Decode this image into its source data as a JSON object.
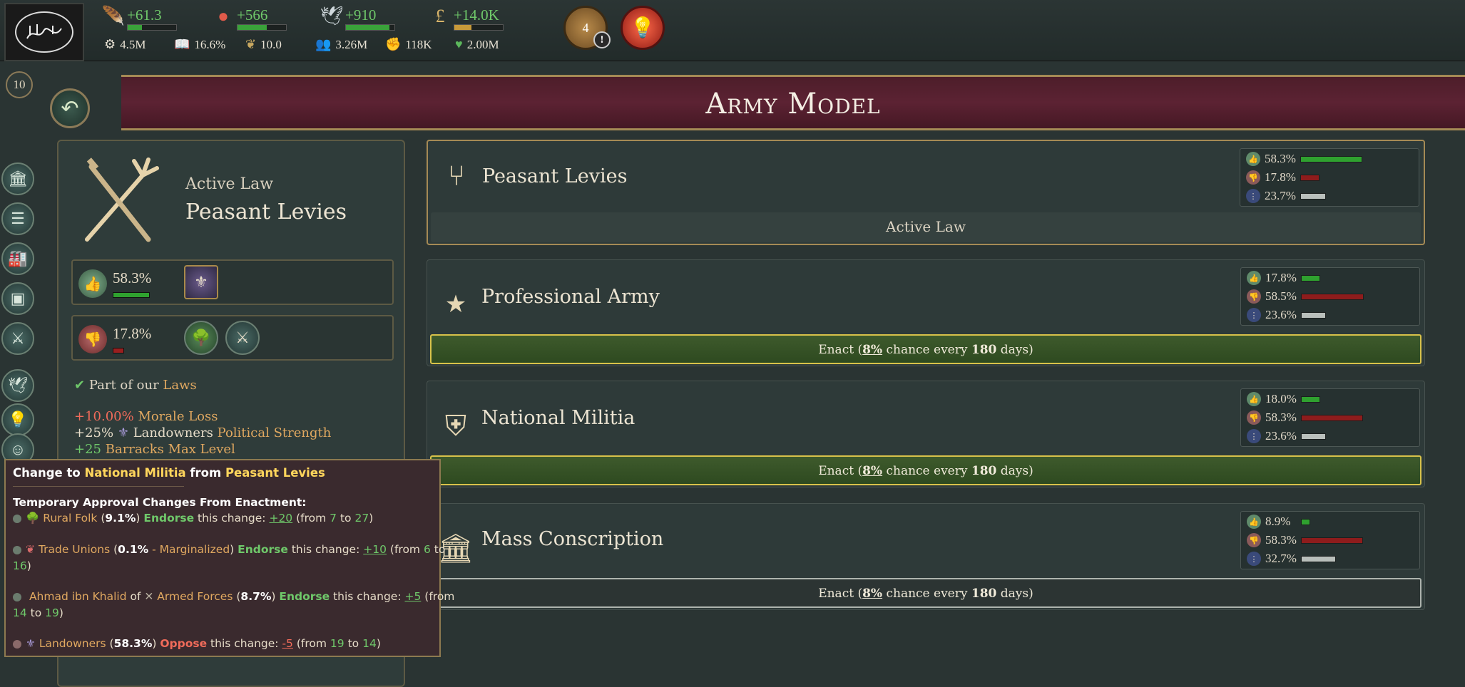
{
  "top": {
    "resources": [
      {
        "icon": "quill-icon",
        "value": "+61.3",
        "fill": 0.3
      },
      {
        "icon": "influence-icon",
        "value": "+566",
        "fill": 0.6
      },
      {
        "icon": "dove-icon",
        "value": "+910",
        "fill": 0.9
      },
      {
        "icon": "pound-icon",
        "value": "+14.0K",
        "fill": 0.35
      }
    ],
    "stats": [
      {
        "icon": "gdp-icon",
        "value": "4.5M"
      },
      {
        "icon": "literacy-icon",
        "value": "16.6%"
      },
      {
        "icon": "wheat-icon",
        "value": "10.0"
      },
      {
        "icon": "population-icon",
        "value": "3.26M"
      },
      {
        "icon": "fist-icon",
        "value": "118K"
      },
      {
        "icon": "heart-icon",
        "value": "2.00M"
      }
    ],
    "journal_count": "4",
    "journal_alert": "!"
  },
  "header": {
    "title": "Army Model",
    "date_badge": "10"
  },
  "active_law": {
    "label": "Active Law",
    "name": "Peasant Levies",
    "approve_pct": "58.3%",
    "approve_fill": 0.583,
    "oppose_pct": "17.8%",
    "oppose_fill": 0.178,
    "part_of": "Part of our ",
    "part_of_link": "Laws",
    "effects": [
      {
        "value": "+10.00%",
        "label": "Morale Loss"
      },
      {
        "value": "+25%",
        "group": "Landowners",
        "label": "Political Strength"
      },
      {
        "value": "+25",
        "label": "Barracks Max Level"
      }
    ]
  },
  "laws": [
    {
      "name": "Peasant Levies",
      "approve": "58.3%",
      "oppose": "17.8%",
      "neutral": "23.7%",
      "approve_fill": 0.583,
      "oppose_fill": 0.178,
      "neutral_fill": 0.237,
      "footer": "Active Law"
    },
    {
      "name": "Professional Army",
      "approve": "17.8%",
      "oppose": "58.5%",
      "neutral": "23.6%",
      "approve_fill": 0.178,
      "oppose_fill": 0.585,
      "neutral_fill": 0.236,
      "enact_prefix": "Enact (",
      "chance": "8%",
      "enact_mid": " chance every ",
      "days": "180",
      "enact_suffix": " days)"
    },
    {
      "name": "National Militia",
      "approve": "18.0%",
      "oppose": "58.3%",
      "neutral": "23.6%",
      "approve_fill": 0.18,
      "oppose_fill": 0.583,
      "neutral_fill": 0.236,
      "enact_prefix": "Enact (",
      "chance": "8%",
      "enact_mid": " chance every ",
      "days": "180",
      "enact_suffix": " days)"
    },
    {
      "name": "Mass Conscription",
      "approve": "8.9%",
      "oppose": "58.3%",
      "neutral": "32.7%",
      "approve_fill": 0.089,
      "oppose_fill": 0.583,
      "neutral_fill": 0.327,
      "enact_prefix": "Enact (",
      "chance": "8%",
      "enact_mid": " chance every ",
      "days": "180",
      "enact_suffix": " days)"
    }
  ],
  "tooltip": {
    "title_pre": "Change to ",
    "title_to": "National Militia",
    "title_mid": " from ",
    "title_from": "Peasant Levies",
    "section": "Temporary Approval Changes From Enactment:",
    "rural_folk": {
      "group": "Rural Folk",
      "pct": "9.1%",
      "verb": "Endorse",
      "mid": " this change: ",
      "delta": "+20",
      "from": "7",
      "to": "27"
    },
    "trade_unions": {
      "group": "Trade Unions",
      "pct": "0.1%",
      "note": " - Marginalized",
      "verb": "Endorse",
      "mid": " this change: ",
      "delta": "+10",
      "from": "6",
      "to": "16"
    },
    "ahmad": {
      "person": "Ahmad ibn Khalid",
      "of": " of ",
      "group": "Armed Forces",
      "pct": "8.7%",
      "verb": "Endorse",
      "mid": " this change: ",
      "delta": "+5",
      "from": "14",
      "to": "19"
    },
    "landowners": {
      "group": "Landowners",
      "pct": "58.3%",
      "verb": "Oppose",
      "mid": " this change: ",
      "delta": "-5",
      "from": "19",
      "to": "14"
    },
    "from_word": "(from ",
    "to_word": " to "
  },
  "colors": {
    "approve": "#2fa12f",
    "oppose": "#8e1c1c",
    "neutral": "#b9bfbb",
    "banner": "#5c2233",
    "gold_border": "#a58a55"
  }
}
